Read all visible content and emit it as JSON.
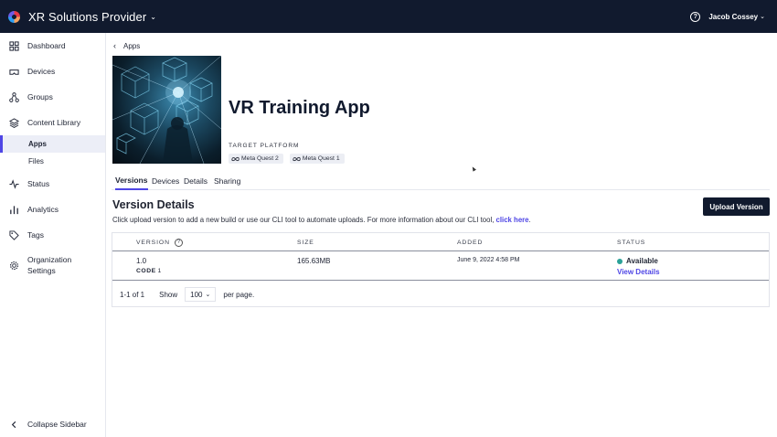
{
  "header": {
    "org_name": "XR Solutions Provider",
    "user_name": "Jacob Cossey",
    "help_icon": "?",
    "colors": {
      "background": "#111a2e",
      "accent": "#4f46e5"
    }
  },
  "sidebar": {
    "items": [
      {
        "label": "Dashboard",
        "icon": "grid-icon"
      },
      {
        "label": "Devices",
        "icon": "vr-headset-icon"
      },
      {
        "label": "Groups",
        "icon": "network-icon"
      },
      {
        "label": "Content Library",
        "icon": "layers-icon"
      },
      {
        "label": "Status",
        "icon": "pulse-icon"
      },
      {
        "label": "Analytics",
        "icon": "bar-chart-icon"
      },
      {
        "label": "Tags",
        "icon": "tag-icon"
      },
      {
        "label": "Organization Settings",
        "icon": "gear-icon"
      }
    ],
    "sub_items": [
      {
        "label": "Apps",
        "active": true
      },
      {
        "label": "Files",
        "active": false
      }
    ],
    "collapse_label": "Collapse Sidebar"
  },
  "breadcrumb": {
    "back_label": "Apps"
  },
  "app": {
    "title": "VR Training App",
    "target_platform_label": "TARGET PLATFORM",
    "platforms": [
      "Meta Quest 2",
      "Meta Quest 1"
    ]
  },
  "tabs": [
    {
      "label": "Versions",
      "active": true
    },
    {
      "label": "Devices",
      "active": false
    },
    {
      "label": "Details",
      "active": false
    },
    {
      "label": "Sharing",
      "active": false
    }
  ],
  "versions": {
    "title": "Version Details",
    "description": "Click upload version to add a new build or use our CLI tool to automate uploads. For more information about our CLI tool, ",
    "link_text": "click here",
    "description_end": ".",
    "upload_button": "Upload Version",
    "columns": [
      "VERSION",
      "SIZE",
      "ADDED",
      "STATUS"
    ],
    "rows": [
      {
        "version": "1.0",
        "code_label": "CODE",
        "code_value": "1",
        "size": "165.63MB",
        "added": "June 9, 2022 4:58 PM",
        "status": "Available",
        "status_color": "#2aa198",
        "action": "View Details"
      }
    ],
    "pagination": {
      "range": "1-1 of 1",
      "show_label": "Show",
      "page_size": "100",
      "per_page_label": "per page."
    }
  }
}
